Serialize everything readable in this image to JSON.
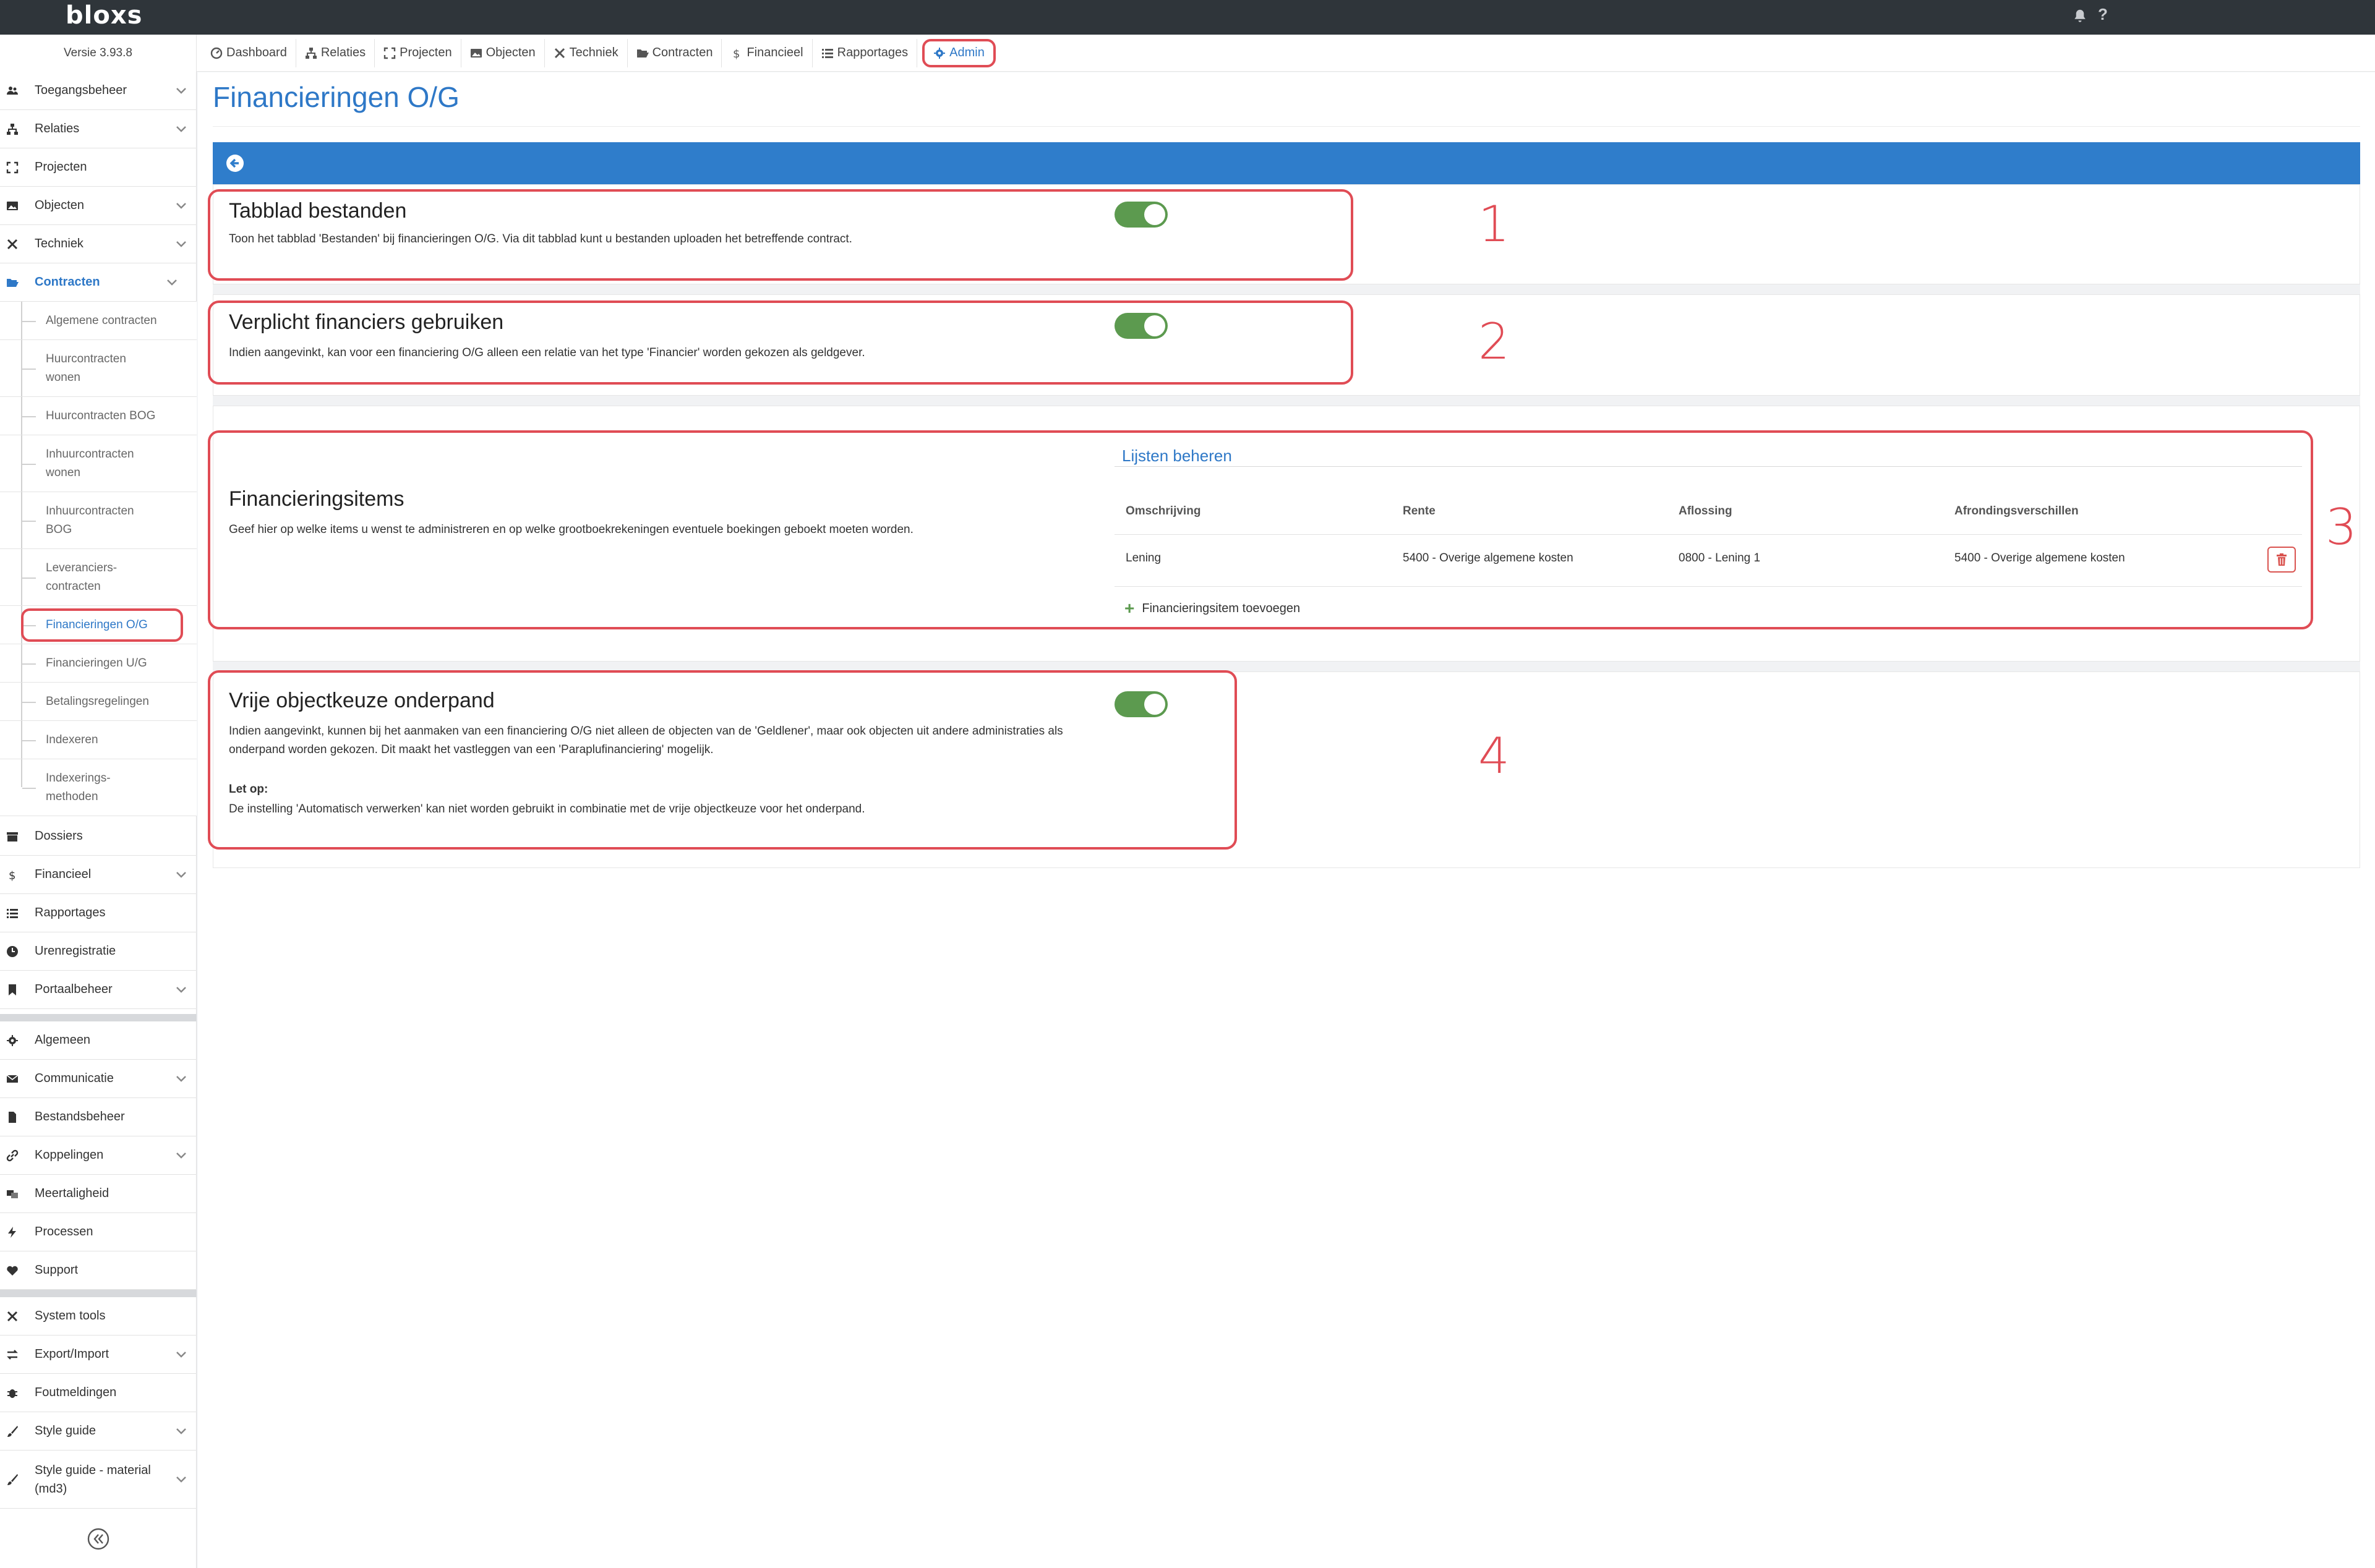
{
  "app": {
    "logo": "bloxs",
    "version": "Versie 3.93.8",
    "help": "?"
  },
  "topnav": [
    {
      "label": "Dashboard",
      "icon": "dashboard-icon"
    },
    {
      "label": "Relaties",
      "icon": "sitemap-icon"
    },
    {
      "label": "Projecten",
      "icon": "expand-icon"
    },
    {
      "label": "Objecten",
      "icon": "image-icon"
    },
    {
      "label": "Techniek",
      "icon": "tools-icon"
    },
    {
      "label": "Contracten",
      "icon": "folder-open-icon"
    },
    {
      "label": "Financieel",
      "icon": "dollar-icon"
    },
    {
      "label": "Rapportages",
      "icon": "list-icon"
    },
    {
      "label": "Admin",
      "icon": "gear-icon",
      "active": true
    }
  ],
  "sidebar": {
    "items": [
      {
        "label": "Toegangsbeheer",
        "icon": "users-icon"
      },
      {
        "label": "Relaties",
        "icon": "sitemap-icon"
      },
      {
        "label": "Projecten",
        "icon": "expand-icon"
      },
      {
        "label": "Objecten",
        "icon": "image-icon"
      },
      {
        "label": "Techniek",
        "icon": "tools-icon"
      },
      {
        "label": "Contracten",
        "icon": "folder-open-icon",
        "open": true
      },
      {
        "label": "Dossiers",
        "icon": "archive-icon"
      },
      {
        "label": "Financieel",
        "icon": "dollar-icon"
      },
      {
        "label": "Rapportages",
        "icon": "list-icon"
      },
      {
        "label": "Urenregistratie",
        "icon": "clock-icon"
      },
      {
        "label": "Portaalbeheer",
        "icon": "bookmark-icon"
      },
      {
        "label": "Algemeen",
        "icon": "gear-icon"
      },
      {
        "label": "Communicatie",
        "icon": "envelope-icon"
      },
      {
        "label": "Bestandsbeheer",
        "icon": "file-icon"
      },
      {
        "label": "Koppelingen",
        "icon": "link-icon"
      },
      {
        "label": "Meertaligheid",
        "icon": "language-icon"
      },
      {
        "label": "Processen",
        "icon": "bolt-icon"
      },
      {
        "label": "Support",
        "icon": "heart-icon"
      },
      {
        "label": "System tools",
        "icon": "tools-icon"
      },
      {
        "label": "Export/Import",
        "icon": "exchange-icon"
      },
      {
        "label": "Foutmeldingen",
        "icon": "bug-icon"
      },
      {
        "label": "Style guide",
        "icon": "brush-icon"
      },
      {
        "label": "Style guide - material (md3)",
        "icon": "brush-icon"
      }
    ],
    "contract_subitems": [
      "Algemene contracten",
      "Huurcontracten wonen",
      "Huurcontracten BOG",
      "Inhuurcontracten wonen",
      "Inhuurcontracten BOG",
      "Leveranciers-contracten",
      "Financieringen O/G",
      "Financieringen U/G",
      "Betalingsregelingen",
      "Indexeren",
      "Indexerings-methoden"
    ],
    "active_subitem": "Financieringen O/G"
  },
  "page": {
    "title": "Financieringen O/G"
  },
  "settings": [
    {
      "title": "Tabblad bestanden",
      "desc": "Toon het tabblad 'Bestanden' bij financieringen O/G. Via dit tabblad kunt u bestanden uploaden het betreffende contract.",
      "enabled": true,
      "annotation": "1"
    },
    {
      "title": "Verplicht financiers gebruiken",
      "desc": "Indien aangevinkt, kan voor een financiering O/G alleen een relatie van het type 'Financier' worden gekozen als geldgever.",
      "enabled": true,
      "annotation": "2"
    },
    {
      "title": "Financieringsitems",
      "desc": "Geef hier op welke items u wenst te administreren en op welke grootboekrekeningen eventuele boekingen geboekt moeten worden.",
      "annotation": "3"
    },
    {
      "title": "Vrije objectkeuze onderpand",
      "desc": "Indien aangevinkt, kunnen bij het aanmaken van een financiering O/G niet alleen de objecten van de 'Geldlener', maar ook objecten uit andere administraties als onderpand worden gekozen. Dit maakt het vastleggen van een 'Paraplufinanciering' mogelijk.",
      "note_label": "Let op:",
      "note": "De instelling 'Automatisch verwerken' kan niet worden gebruikt in combinatie met de vrije objectkeuze voor het onderpand.",
      "enabled": true,
      "annotation": "4"
    }
  ],
  "financieringsitems": {
    "link": "Lijsten beheren",
    "columns": [
      "Omschrijving",
      "Rente",
      "Aflossing",
      "Afrondingsverschillen"
    ],
    "rows": [
      [
        "Lening",
        "5400 - Overige algemene kosten",
        "0800 - Lening 1",
        "5400 - Overige algemene kosten"
      ]
    ],
    "add_label": "Financieringsitem toevoegen"
  },
  "colors": {
    "accent": "#2e78c7",
    "topbar": "#2f353a",
    "toggle_on": "#5c9a4f",
    "annotation": "#e04c55",
    "danger": "#d9534f"
  }
}
